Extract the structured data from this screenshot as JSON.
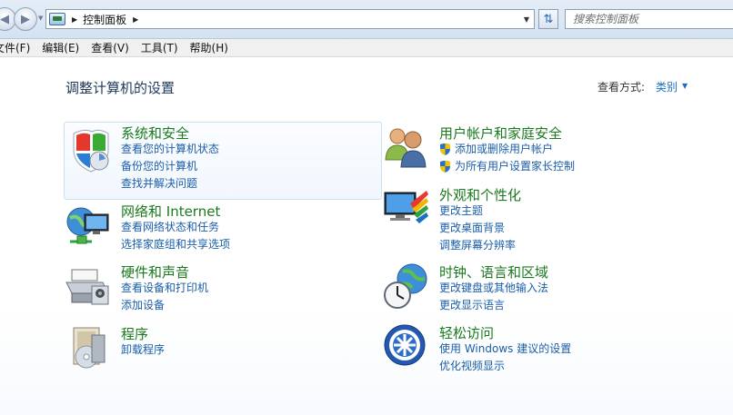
{
  "address": {
    "breadcrumb": "控制面板",
    "search_placeholder": "搜索控制面板"
  },
  "menu": [
    "文件(F)",
    "编辑(E)",
    "查看(V)",
    "工具(T)",
    "帮助(H)"
  ],
  "content": {
    "title": "调整计算机的设置",
    "view_by_label": "查看方式:",
    "view_by_value": "类别"
  },
  "categories": [
    {
      "title": "系统和安全",
      "icon": "shield-icon",
      "links": [
        "查看您的计算机状态",
        "备份您的计算机",
        "查找并解决问题"
      ]
    },
    {
      "title": "网络和 Internet",
      "icon": "network-icon",
      "links": [
        "查看网络状态和任务",
        "选择家庭组和共享选项"
      ]
    },
    {
      "title": "硬件和声音",
      "icon": "printer-icon",
      "links": [
        "查看设备和打印机",
        "添加设备"
      ]
    },
    {
      "title": "程序",
      "icon": "programs-icon",
      "links": [
        "卸载程序"
      ]
    },
    {
      "title": "用户帐户和家庭安全",
      "icon": "users-icon",
      "links": [
        "添加或删除用户帐户",
        "为所有用户设置家长控制"
      ]
    },
    {
      "title": "外观和个性化",
      "icon": "monitor-icon",
      "links": [
        "更改主题",
        "更改桌面背景",
        "调整屏幕分辨率"
      ]
    },
    {
      "title": "时钟、语言和区域",
      "icon": "clock-globe-icon",
      "links": [
        "更改键盘或其他输入法",
        "更改显示语言"
      ]
    },
    {
      "title": "轻松访问",
      "icon": "ease-of-access-icon",
      "links": [
        "使用 Windows 建议的设置",
        "优化视频显示"
      ]
    }
  ]
}
